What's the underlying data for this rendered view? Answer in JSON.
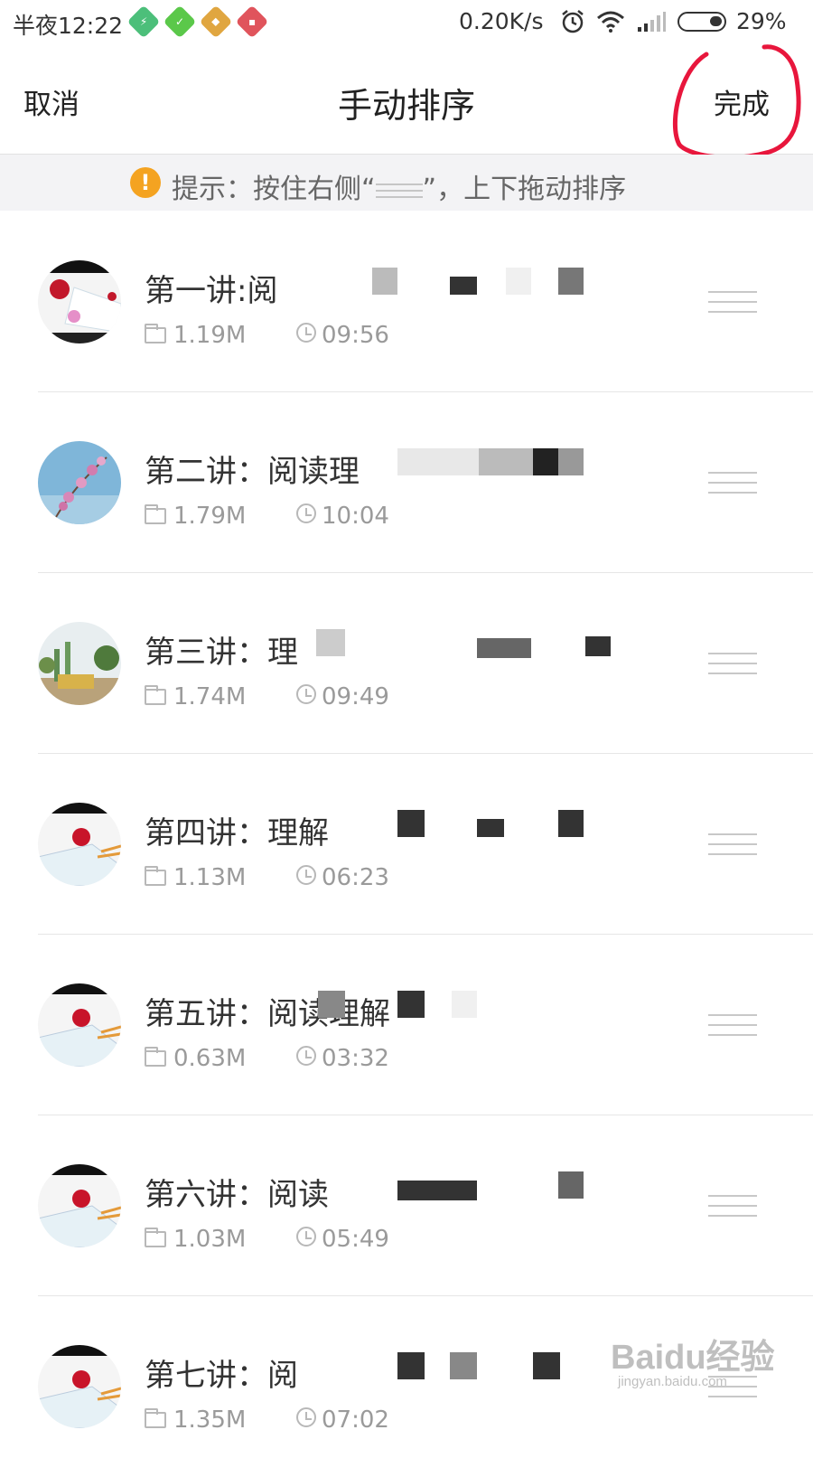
{
  "status_bar": {
    "time": "半夜12:22",
    "net_speed": "0.20K/s",
    "battery": "29%",
    "app_icons": [
      "green-app-icon",
      "green-app-icon",
      "yellow-app-icon",
      "red-app-icon"
    ]
  },
  "header": {
    "cancel": "取消",
    "title": "手动排序",
    "done": "完成"
  },
  "hint": {
    "prefix": "提示：按住右侧“",
    "suffix": "”，上下拖动排序"
  },
  "items": [
    {
      "title": "第一讲:阅",
      "size": "1.19M",
      "duration": "09:56"
    },
    {
      "title": "第二讲：阅读理",
      "size": "1.79M",
      "duration": "10:04"
    },
    {
      "title": "第三讲：理",
      "size": "1.74M",
      "duration": "09:49"
    },
    {
      "title": "第四讲：理解",
      "size": "1.13M",
      "duration": "06:23"
    },
    {
      "title": "第五讲：阅读理解",
      "size": "0.63M",
      "duration": "03:32"
    },
    {
      "title": "第六讲：阅读",
      "size": "1.03M",
      "duration": "05:49"
    },
    {
      "title": "第七讲：阅",
      "size": "1.35M",
      "duration": "07:02"
    }
  ],
  "watermark": {
    "brand": "Baidu经验",
    "url": "jingyan.baidu.com"
  },
  "colors": {
    "hint_icon": "#f4a321",
    "annotation": "#e8163c"
  }
}
